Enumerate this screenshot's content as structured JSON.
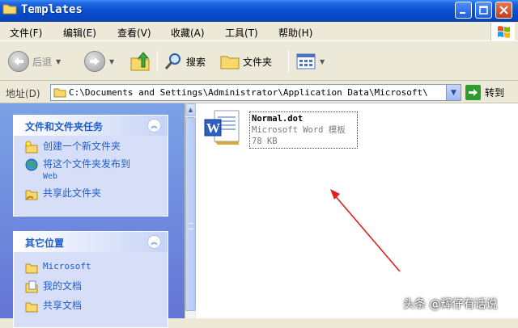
{
  "window": {
    "title": "Templates"
  },
  "menu": [
    "文件(F)",
    "编辑(E)",
    "查看(V)",
    "收藏(A)",
    "工具(T)",
    "帮助(H)"
  ],
  "toolbar": {
    "back_label": "后退",
    "search_label": "搜索",
    "folders_label": "文件夹"
  },
  "address": {
    "label": "地址(D)",
    "path": "C:\\Documents and Settings\\Administrator\\Application Data\\Microsoft\\",
    "go_label": "转到"
  },
  "tasks_panel": {
    "title": "文件和文件夹任务",
    "items": [
      {
        "label": "创建一个新文件夹",
        "icon": "new-folder-icon"
      },
      {
        "label": "将这个文件夹发布到",
        "label2": "Web",
        "icon": "publish-web-icon"
      },
      {
        "label": "共享此文件夹",
        "icon": "share-folder-icon"
      }
    ]
  },
  "places_panel": {
    "title": "其它位置",
    "items": [
      {
        "label": "Microsoft",
        "icon": "folder-icon"
      },
      {
        "label": "我的文档",
        "icon": "my-documents-icon"
      },
      {
        "label": "共享文档",
        "icon": "shared-documents-icon"
      }
    ]
  },
  "file": {
    "name": "Normal.dot",
    "type": "Microsoft Word 模板",
    "size": "78 KB",
    "icon": "word-document-icon"
  },
  "watermark": "头条 @辉仔有话说",
  "colors": {
    "title_bar": "#0a4fd1",
    "task_pane": "#6f8ee0",
    "link": "#215dc6",
    "annotation_arrow": "#e02020"
  }
}
